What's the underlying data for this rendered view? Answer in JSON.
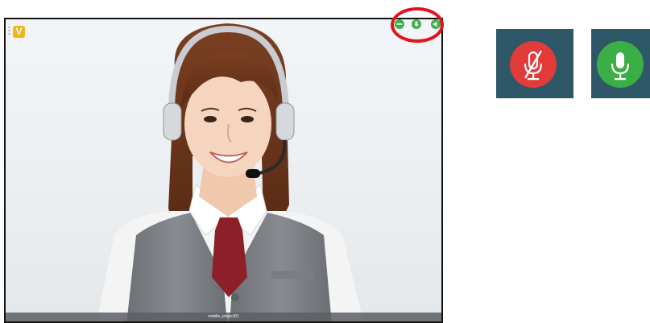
{
  "video": {
    "badge": "V",
    "caption": "mobile_project01"
  },
  "controls": {
    "left": "minimize-icon",
    "mid": "microphone-icon",
    "right": "speaker-icon",
    "highlight_color": "#e3121c"
  },
  "legend": {
    "muted": {
      "icon": "microphone-muted-icon",
      "color": "#e23b39"
    },
    "live": {
      "icon": "microphone-icon",
      "color": "#3bae45"
    },
    "tile_color": "#2e5868"
  }
}
